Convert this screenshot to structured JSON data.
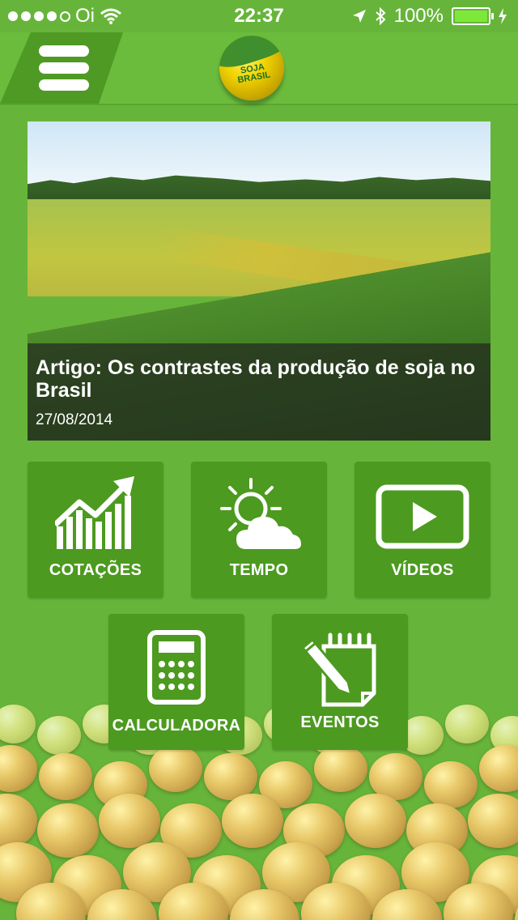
{
  "status_bar": {
    "carrier": "Oi",
    "time": "22:37",
    "battery": "100%"
  },
  "app": {
    "logo_text_1": "SOJA",
    "logo_text_2": "BRASIL"
  },
  "article": {
    "title": "Artigo: Os contrastes da produção de soja no Brasil",
    "date": "27/08/2014"
  },
  "tiles": {
    "cotacoes": "COTAÇÕES",
    "tempo": "TEMPO",
    "videos": "VÍDEOS",
    "calculadora": "CALCULADORA",
    "eventos": "EVENTOS"
  },
  "icons": {
    "menu": "hamburger-icon",
    "cotacoes": "chart-trend-icon",
    "tempo": "sun-cloud-icon",
    "videos": "play-video-icon",
    "calculadora": "calculator-icon",
    "eventos": "notepad-pencil-icon"
  },
  "colors": {
    "background": "#66b53a",
    "tile": "#4c9a1f",
    "nav": "#6bbb3c",
    "menu_button": "#4e9a24"
  }
}
